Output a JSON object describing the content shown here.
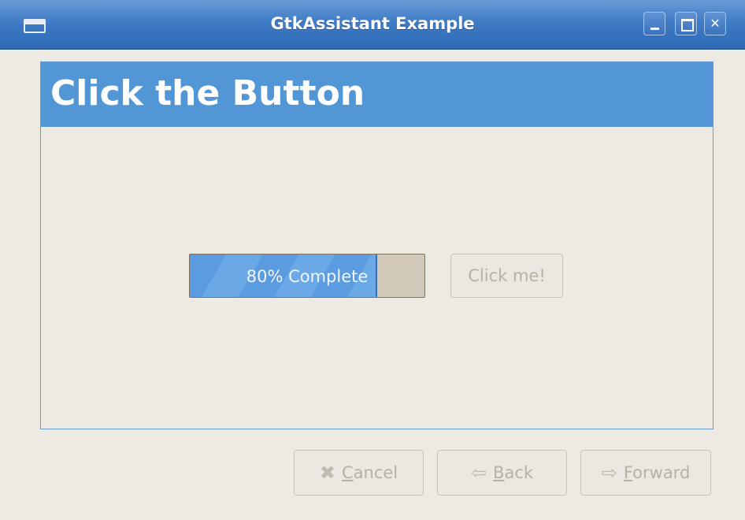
{
  "window": {
    "title": "GtkAssistant Example"
  },
  "page": {
    "title": "Click the Button"
  },
  "progress": {
    "value": 0.8,
    "text": "80% Complete"
  },
  "content": {
    "click_label": "Click me!"
  },
  "footer": {
    "cancel": {
      "label": "Cancel",
      "icon": "cancel-x-icon"
    },
    "back": {
      "label": "Back",
      "icon": "left-arrow-icon"
    },
    "forward": {
      "label": "Forward",
      "icon": "right-arrow-icon"
    }
  }
}
